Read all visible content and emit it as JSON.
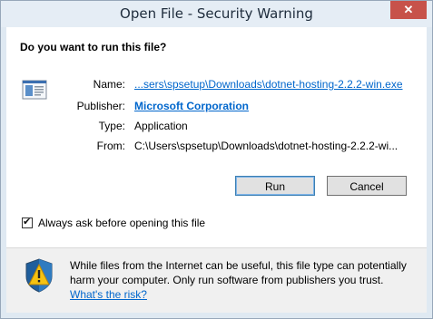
{
  "window": {
    "title": "Open File - Security Warning",
    "close_glyph": "✕"
  },
  "question": "Do you want to run this file?",
  "fields": [
    {
      "label": "Name:",
      "value": "...sers\\spsetup\\Downloads\\dotnet-hosting-2.2.2-win.exe",
      "style": "link"
    },
    {
      "label": "Publisher:",
      "value": "Microsoft Corporation",
      "style": "linkb"
    },
    {
      "label": "Type:",
      "value": "Application",
      "style": "plain"
    },
    {
      "label": "From:",
      "value": "C:\\Users\\spsetup\\Downloads\\dotnet-hosting-2.2.2-wi...",
      "style": "plain"
    }
  ],
  "buttons": {
    "run": "Run",
    "cancel": "Cancel"
  },
  "checkbox": {
    "label": "Always ask before opening this file",
    "checked": true,
    "check_glyph": "✔"
  },
  "warning": {
    "text": "While files from the Internet can be useful, this file type can potentially harm your computer. Only run software from publishers you trust.",
    "link": "What's the risk?"
  },
  "colors": {
    "link": "#0066cc",
    "close_button": "#c7524a"
  },
  "icons": {
    "file": "application-file-icon",
    "shield": "warning-shield-icon"
  }
}
